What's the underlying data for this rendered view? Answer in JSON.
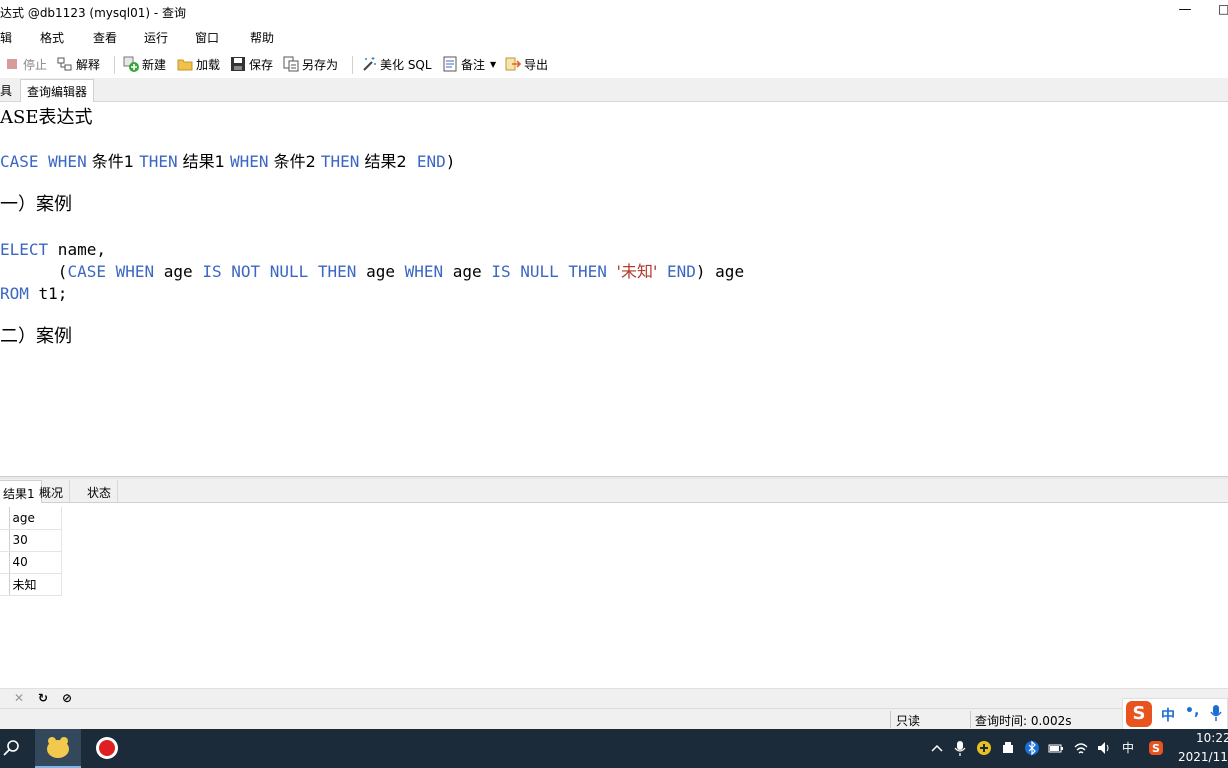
{
  "window": {
    "title": "达式 @db1123 (mysql01) - 查询",
    "minimize_glyph": "—",
    "maximize_glyph": "□"
  },
  "menu": [
    {
      "label": "辑"
    },
    {
      "label": "格式"
    },
    {
      "label": "查看"
    },
    {
      "label": "运行"
    },
    {
      "label": "窗口"
    },
    {
      "label": "帮助"
    }
  ],
  "toolbar": {
    "stop_label": "停止",
    "explain_label": "解释",
    "new_label": "新建",
    "load_label": "加载",
    "save_label": "保存",
    "save_as_label": "另存为",
    "beautify_label": "美化 SQL",
    "memo_label": "备注",
    "export_label": "导出"
  },
  "doc_tabs": [
    {
      "label": "具"
    },
    {
      "label": "查询编辑器"
    }
  ],
  "editor": {
    "line1": "ASE表达式",
    "line2": {
      "kw1": "CASE WHEN",
      "t1": " 条件1 ",
      "kw2": "THEN",
      "t2": " 结果1 ",
      "kw3": "WHEN",
      "t3": " 条件2 ",
      "kw4": "THEN",
      "t4": " 结果2  ",
      "kw5": "END",
      "t5": ")"
    },
    "line3": "一）案例",
    "line4": {
      "kw1": "ELECT",
      "t1": " name,"
    },
    "line5": {
      "t0": "      (",
      "kw1": "CASE WHEN",
      "t1": " age ",
      "kw2": "IS NOT NULL THEN",
      "t2": " age ",
      "kw3": "WHEN",
      "t3": " age ",
      "kw4": "IS NULL THEN",
      "t4": " ",
      "str1": "'未知'",
      "t5": " ",
      "kw5": "END",
      "t6": ") age"
    },
    "line6": {
      "kw1": "ROM",
      "t1": " t1;"
    },
    "line7": "二）案例"
  },
  "result_tabs": [
    {
      "label": "结果1"
    },
    {
      "label": "概况"
    },
    {
      "label": "状态"
    }
  ],
  "result_grid": {
    "columns": [
      "age"
    ],
    "rows": [
      [
        "30"
      ],
      [
        "40"
      ],
      [
        "未知"
      ]
    ]
  },
  "bottom_icons": {
    "clear": "✕",
    "refresh": "↻",
    "stop": "⊘"
  },
  "status": {
    "mode": "只读",
    "query_time": "查询时间: 0.002s"
  },
  "ime": {
    "logo": "S",
    "lang": "中",
    "punct": "•,"
  },
  "taskbar": {
    "tray_lang": "中",
    "time": "10:22",
    "date": "2021/11/"
  }
}
